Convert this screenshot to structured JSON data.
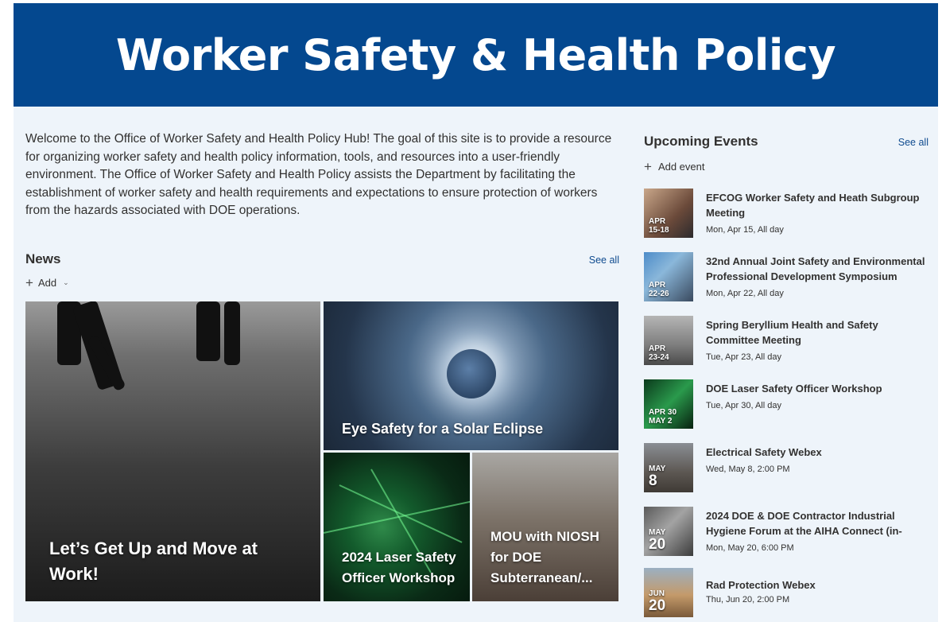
{
  "banner": {
    "title": "Worker Safety & Health Policy"
  },
  "intro": "Welcome to the Office of Worker Safety and Health Policy Hub! The goal of this site is to provide a resource for organizing worker safety and health policy information, tools, and resources into a user-friendly environment.  The Office of Worker Safety and Health Policy assists the Department by facilitating the establishment of worker safety and health requirements and expectations to ensure protection of workers from the hazards associated with DOE operations.",
  "news": {
    "title": "News",
    "see_all": "See all",
    "add_label": "Add",
    "add_icon": "plus-icon",
    "items": [
      {
        "title": "Let’s Get Up and Move at Work!"
      },
      {
        "title": "Eye Safety for a Solar Eclipse"
      },
      {
        "title": "2024 Laser Safety Officer Workshop"
      },
      {
        "title": "MOU with NIOSH for DOE Subterranean/..."
      }
    ]
  },
  "events": {
    "title": "Upcoming Events",
    "see_all": "See all",
    "add_label": "Add event",
    "items": [
      {
        "month": "APR",
        "day": "15-18",
        "title": "EFCOG Worker Safety and Heath Subgroup Meeting",
        "time": "Mon, Apr 15, All day"
      },
      {
        "month": "APR",
        "day": "22-26",
        "title": "32nd Annual Joint Safety and Environmental Professional Development Symposium",
        "time": "Mon, Apr 22, All day"
      },
      {
        "month": "APR",
        "day": "23-24",
        "title": "Spring Beryllium Health and Safety Committee Meeting",
        "time": "Tue, Apr 23, All day"
      },
      {
        "month": "APR 30",
        "day": "MAY 2",
        "title": "DOE Laser Safety Officer Workshop",
        "time": "Tue, Apr 30, All day"
      },
      {
        "month": "MAY",
        "day": "8",
        "title": "Electrical Safety Webex",
        "time": "Wed, May 8, 2:00 PM"
      },
      {
        "month": "MAY",
        "day": "20",
        "title": "2024 DOE & DOE Contractor Industrial Hygiene Forum at the AIHA Connect (in-",
        "time": "Mon, May 20, 6:00 PM"
      },
      {
        "month": "JUN",
        "day": "20",
        "title": "Rad Protection Webex",
        "time": "Thu, Jun 20, 2:00 PM"
      }
    ]
  },
  "colors": {
    "banner": "#04488f",
    "background": "#eef4fa",
    "link": "#0f4b8f"
  }
}
